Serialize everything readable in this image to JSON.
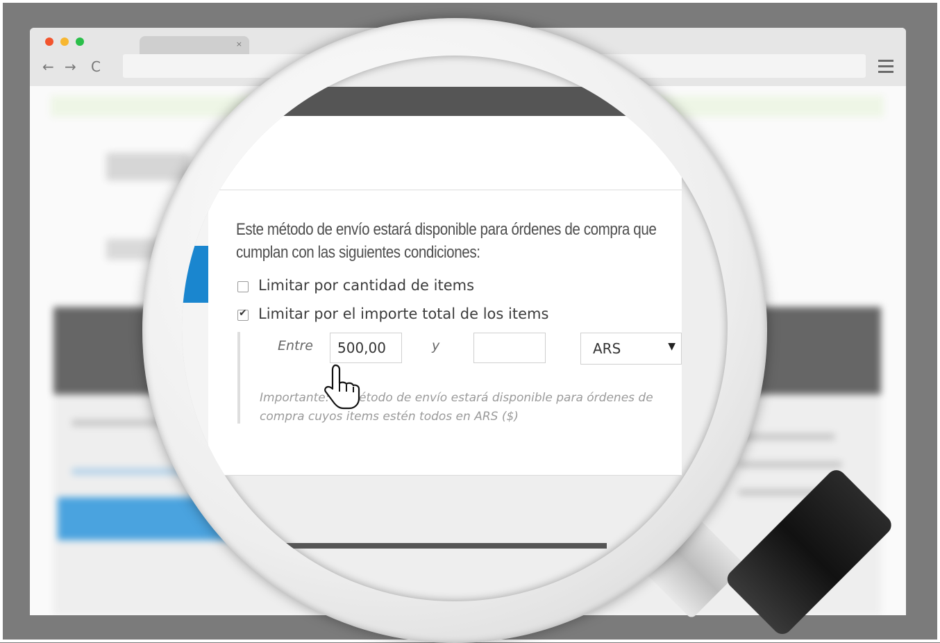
{
  "browser": {
    "tab_close": "×",
    "nav": {
      "back": "←",
      "forward": "→",
      "reload": "C"
    }
  },
  "shipping": {
    "description": "Este método de envío estará disponible para órdenes de compra que cumplan con las siguientes condiciones:",
    "limit_by_quantity": {
      "label": "Limitar por cantidad de items",
      "checked": false
    },
    "limit_by_total": {
      "label": "Limitar por el importe total de los items",
      "checked": true
    },
    "range": {
      "from_label": "Entre",
      "from_value": "500,00",
      "and_label": "y",
      "to_value": "",
      "currency": "ARS"
    },
    "note": "Importante: el método de envío estará disponible para órdenes de compra cuyos items estén todos en ARS ($)"
  },
  "colors": {
    "accent_blue": "#1a86cf",
    "dark_bar": "#555555"
  }
}
